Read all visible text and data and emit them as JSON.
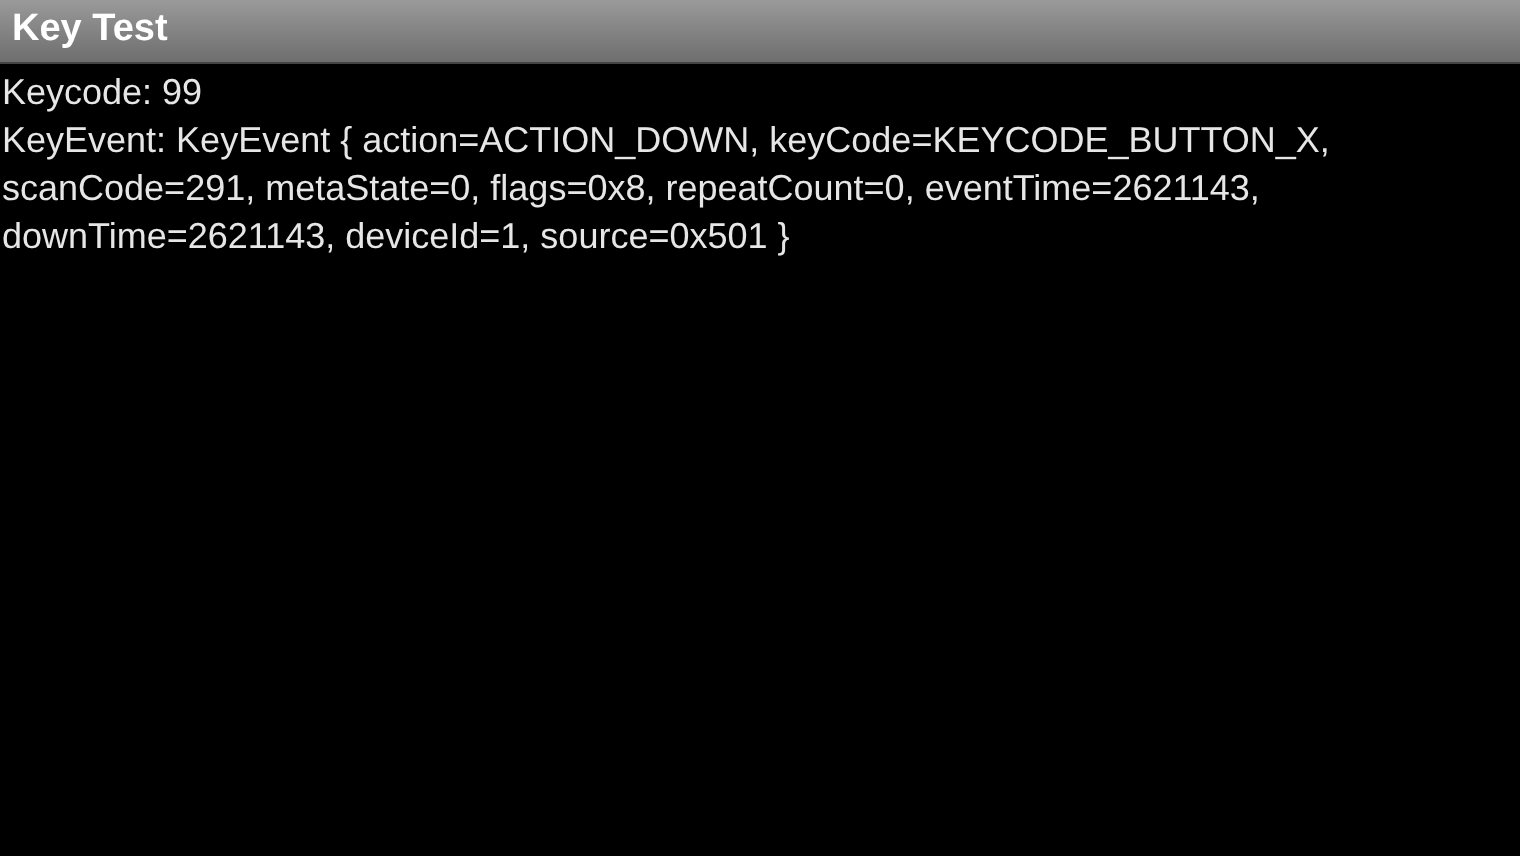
{
  "window": {
    "title": "Key Test"
  },
  "keycode": "Keycode: 99",
  "key_event": "KeyEvent: KeyEvent { action=ACTION_DOWN, keyCode=KEYCODE_BUTTON_X, scanCode=291, metaState=0, flags=0x8, repeatCount=0, eventTime=2621143, downTime=2621143, deviceId=1, source=0x501 }"
}
